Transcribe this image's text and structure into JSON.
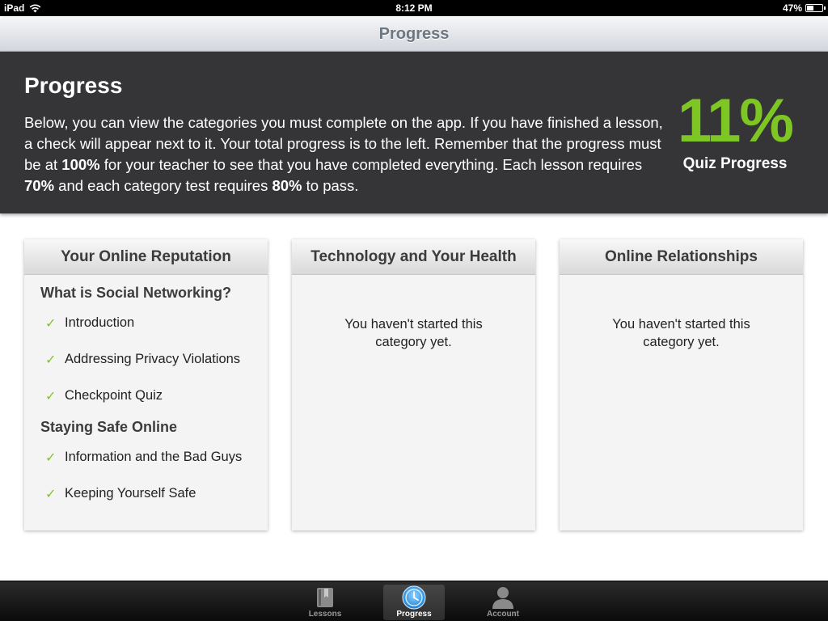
{
  "status_bar": {
    "device": "iPad",
    "time": "8:12 PM",
    "battery": "47%",
    "battery_level": 0.47
  },
  "nav": {
    "title": "Progress"
  },
  "header": {
    "title": "Progress",
    "body_1": "Below, you can view the categories you must complete on the app. If you have finished a lesson, a check will appear next to it. Your total progress is to the left. Remember that the progress must be at ",
    "bold_1": "100%",
    "body_2": " for your teacher to see that you have completed everything. Each lesson requires ",
    "bold_2": "70%",
    "body_3": " and each category test requires ",
    "bold_3": "80%",
    "body_4": " to pass.",
    "quiz_percent": "11%",
    "quiz_label": "Quiz Progress"
  },
  "cards": [
    {
      "title": "Your Online Reputation",
      "sections": [
        {
          "title": "What is Social Networking?",
          "lessons": [
            "Introduction",
            "Addressing Privacy Violations",
            "Checkpoint Quiz"
          ]
        },
        {
          "title": "Staying Safe Online",
          "lessons": [
            "Information and the Bad Guys",
            "Keeping Yourself Safe"
          ]
        }
      ]
    },
    {
      "title": "Technology and Your Health",
      "message": "You haven't started this category yet."
    },
    {
      "title": "Online Relationships",
      "message": "You haven't started this category yet."
    }
  ],
  "check_mark": "✓",
  "tabs": [
    {
      "label": "Lessons",
      "icon": "book-icon",
      "active": false
    },
    {
      "label": "Progress",
      "icon": "clock-icon",
      "active": true
    },
    {
      "label": "Account",
      "icon": "person-icon",
      "active": false
    }
  ],
  "colors": {
    "accent_green": "#7dc623",
    "header_bg": "#353437"
  }
}
